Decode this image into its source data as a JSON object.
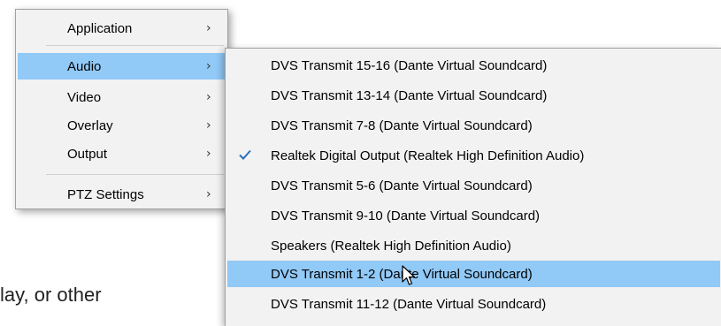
{
  "background_text": "lay, or other",
  "main_menu": {
    "items": [
      {
        "label": "Application",
        "arrow": "›"
      },
      {
        "label": "Audio",
        "arrow": "›",
        "highlighted": true
      },
      {
        "label": "Video",
        "arrow": "›"
      },
      {
        "label": "Overlay",
        "arrow": "›"
      },
      {
        "label": "Output",
        "arrow": "›"
      },
      {
        "label": "PTZ Settings",
        "arrow": "›"
      }
    ]
  },
  "audio_submenu": {
    "items": [
      {
        "label": "DVS Transmit 15-16 (Dante Virtual Soundcard)"
      },
      {
        "label": "DVS Transmit 13-14 (Dante Virtual Soundcard)"
      },
      {
        "label": "DVS Transmit  7-8 (Dante Virtual Soundcard)"
      },
      {
        "label": "Realtek Digital Output (Realtek High Definition Audio)",
        "checked": true
      },
      {
        "label": "DVS Transmit  5-6 (Dante Virtual Soundcard)"
      },
      {
        "label": "DVS Transmit  9-10 (Dante Virtual Soundcard)"
      },
      {
        "label": "Speakers (Realtek High Definition Audio)"
      },
      {
        "label": "DVS Transmit  1-2 (Dante Virtual Soundcard)",
        "highlighted": true
      },
      {
        "label": "DVS Transmit 11-12 (Dante Virtual Soundcard)"
      }
    ]
  },
  "colors": {
    "highlight": "#91c9f7",
    "menu_background": "#f2f2f2",
    "check": "#2a6fb8"
  }
}
